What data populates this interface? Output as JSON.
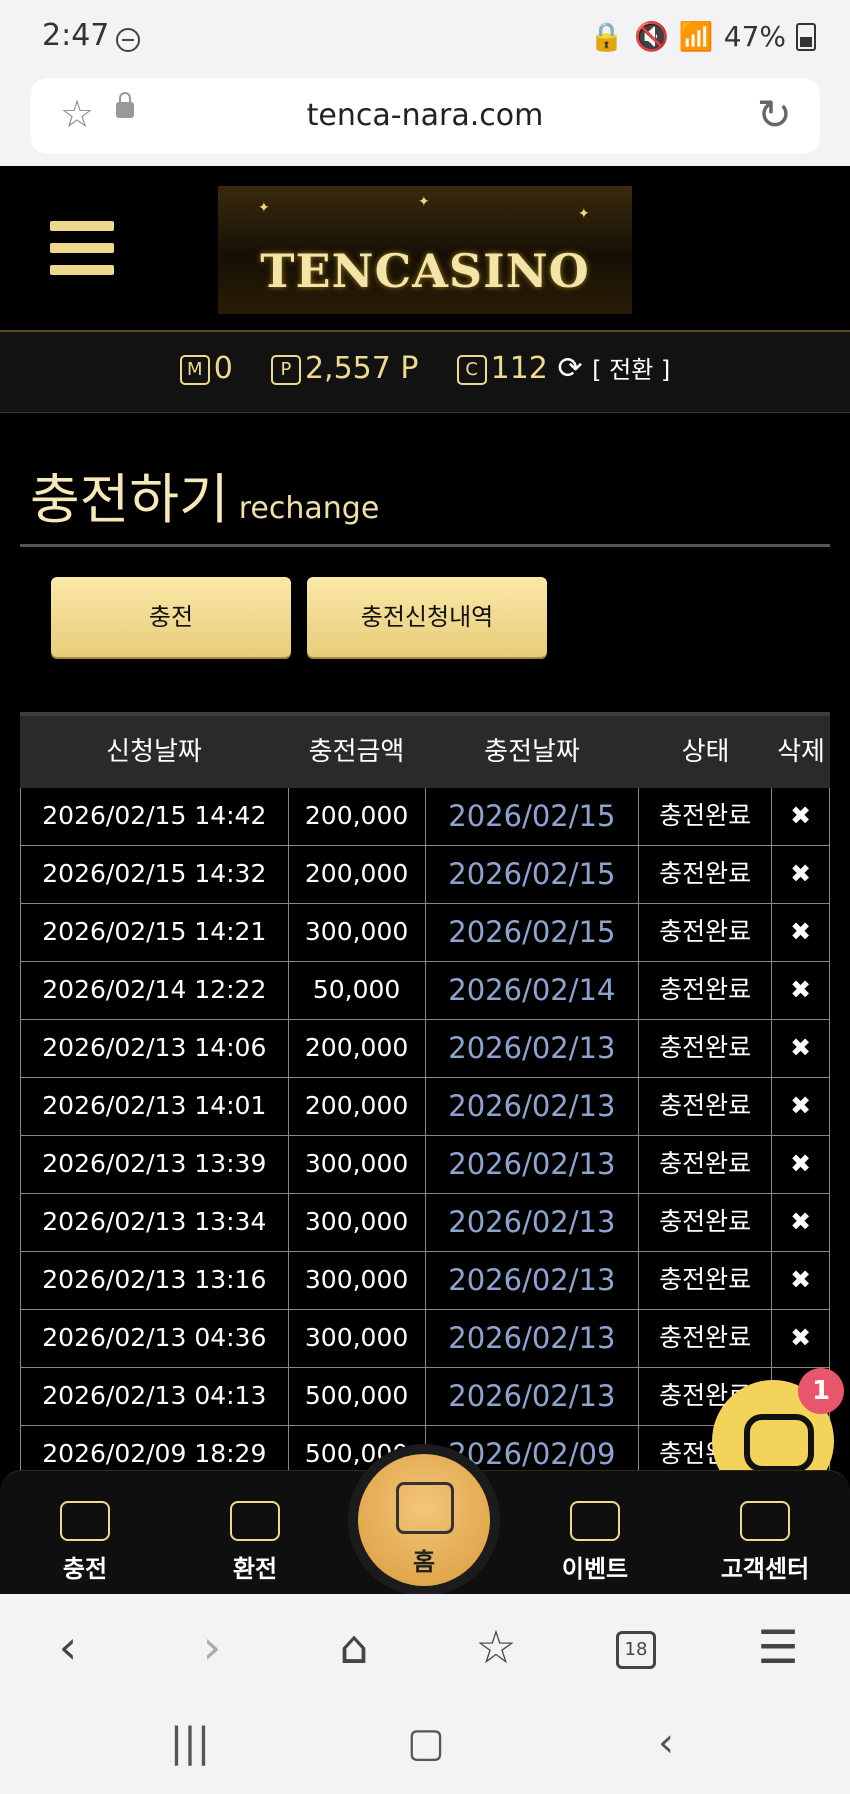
{
  "status_bar": {
    "time": "2:47",
    "battery": "47%"
  },
  "browser": {
    "url": "tenca-nara.com",
    "tab_count": "18"
  },
  "header": {
    "logo_text": "TENCASINO"
  },
  "balance": {
    "m_badge": "M",
    "m_value": "0",
    "p_badge": "P",
    "p_value": "2,557 P",
    "c_badge": "C",
    "c_value": "112",
    "convert_label": "[ 전환 ]"
  },
  "page": {
    "title": "충전하기",
    "subtitle": "rechange"
  },
  "buttons": {
    "charge": "충전",
    "history": "충전신청내역"
  },
  "table": {
    "headers": [
      "신청날짜",
      "충전금액",
      "충전날짜",
      "상태",
      "삭제"
    ],
    "rows": [
      {
        "requested": "2026/02/15 14:42",
        "amount": "200,000",
        "charged": "2026/02/15",
        "status": "충전완료"
      },
      {
        "requested": "2026/02/15 14:32",
        "amount": "200,000",
        "charged": "2026/02/15",
        "status": "충전완료"
      },
      {
        "requested": "2026/02/15 14:21",
        "amount": "300,000",
        "charged": "2026/02/15",
        "status": "충전완료"
      },
      {
        "requested": "2026/02/14 12:22",
        "amount": "50,000",
        "charged": "2026/02/14",
        "status": "충전완료"
      },
      {
        "requested": "2026/02/13 14:06",
        "amount": "200,000",
        "charged": "2026/02/13",
        "status": "충전완료"
      },
      {
        "requested": "2026/02/13 14:01",
        "amount": "200,000",
        "charged": "2026/02/13",
        "status": "충전완료"
      },
      {
        "requested": "2026/02/13 13:39",
        "amount": "300,000",
        "charged": "2026/02/13",
        "status": "충전완료"
      },
      {
        "requested": "2026/02/13 13:34",
        "amount": "300,000",
        "charged": "2026/02/13",
        "status": "충전완료"
      },
      {
        "requested": "2026/02/13 13:16",
        "amount": "300,000",
        "charged": "2026/02/13",
        "status": "충전완료"
      },
      {
        "requested": "2026/02/13 04:36",
        "amount": "300,000",
        "charged": "2026/02/13",
        "status": "충전완료"
      },
      {
        "requested": "2026/02/13 04:13",
        "amount": "500,000",
        "charged": "2026/02/13",
        "status": "충전완료"
      },
      {
        "requested": "2026/02/09 18:29",
        "amount": "500,000",
        "charged": "2026/02/09",
        "status": "충전완료"
      }
    ]
  },
  "bottom_nav": {
    "charge": "충전",
    "exchange": "환전",
    "home": "홈",
    "event": "이벤트",
    "support": "고객센터"
  },
  "chat": {
    "badge": "1"
  }
}
